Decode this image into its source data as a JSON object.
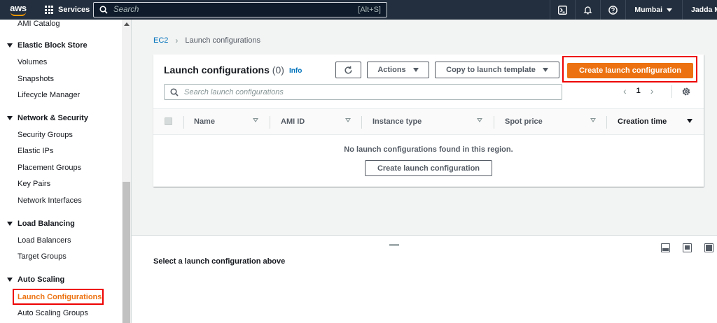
{
  "topnav": {
    "logo_text": "aws",
    "services_label": "Services",
    "search_placeholder": "Search",
    "search_shortcut": "[Alt+S]",
    "region": "Mumbai",
    "user": "Jadda Mu"
  },
  "sidebar": {
    "top_item": "AMI Catalog",
    "sections": [
      {
        "title": "Elastic Block Store",
        "items": [
          "Volumes",
          "Snapshots",
          "Lifecycle Manager"
        ]
      },
      {
        "title": "Network & Security",
        "items": [
          "Security Groups",
          "Elastic IPs",
          "Placement Groups",
          "Key Pairs",
          "Network Interfaces"
        ]
      },
      {
        "title": "Load Balancing",
        "items": [
          "Load Balancers",
          "Target Groups"
        ]
      },
      {
        "title": "Auto Scaling",
        "items": [
          "Launch Configurations",
          "Auto Scaling Groups"
        ]
      }
    ],
    "active_item": "Launch Configurations"
  },
  "breadcrumb": {
    "root": "EC2",
    "current": "Launch configurations"
  },
  "panel": {
    "title": "Launch configurations",
    "count": "(0)",
    "info": "Info",
    "actions_label": "Actions",
    "copy_label": "Copy to launch template",
    "create_label": "Create launch configuration",
    "search_placeholder": "Search launch configurations",
    "page": "1",
    "columns": [
      "Name",
      "AMI ID",
      "Instance type",
      "Spot price",
      "Creation time"
    ],
    "empty_message": "No launch configurations found in this region.",
    "empty_create_label": "Create launch configuration"
  },
  "split_panel": {
    "title": "Select a launch configuration above"
  },
  "colors": {
    "accent": "#ec7211",
    "nav": "#232f3e",
    "link": "#0073bb",
    "highlight": "#ee0000"
  }
}
